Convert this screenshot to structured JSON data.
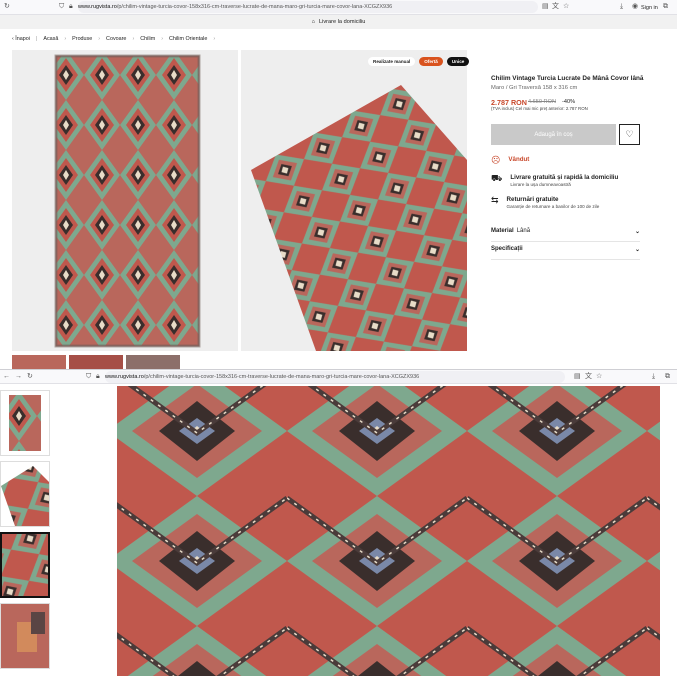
{
  "browser1": {
    "url_host": "www.rugvista.ro",
    "url_path": "/p/chilim-vintage-turcia-covor-158x316-cm-traverse-lucrate-de-mana-maro-gri-turcia-mare-covor-lana-XCGZX936",
    "sign_in": "Sign in"
  },
  "browser2": {
    "url_host": "www.rugvista.ro",
    "url_path": "/p/chilim-vintage-turcia-covor-158x316-cm-traverse-lucrate-de-mana-maro-gri-turcia-mare-covor-lana-XCGZX936"
  },
  "promo": {
    "text": "Livrare la domiciliu"
  },
  "breadcrumb": {
    "back": "Înapoi",
    "items": [
      "Acasă",
      "Produse",
      "Covoare",
      "Chilim",
      "Chilim Orientale"
    ]
  },
  "tags": {
    "manual": "Realizate manual",
    "offer": "Ofertă",
    "unique": "Unice"
  },
  "product": {
    "title": "Chilim Vintage Turcia Lucrate De Mână Covor lână",
    "subtitle": "Maro / Gri Traversă 158 x 316 cm",
    "price": "2.787 RON",
    "old_price": "4.650 RON",
    "discount": "-40%",
    "vat_note": "(TVA inclus) Cel mai mic preț anterior: 2.787 RON",
    "add_to_cart": "Adaugă în coș"
  },
  "features": {
    "sold": "Vândut",
    "free_delivery_title": "Livrare gratuită și rapidă la domiciliu",
    "free_delivery_sub": "Livrare la ușa dumneavoastră",
    "free_returns_title": "Returnări gratuite",
    "free_returns_sub": "Garanție de returnare a banilor de 100 de zile"
  },
  "details": {
    "material_label": "Material",
    "material_value": "Lână",
    "specs_label": "Specificații"
  },
  "colors": {
    "accent": "#c8472a",
    "offer_tag": "#d9531e",
    "rug_red": "#c0584d",
    "rug_green": "#7ea88e",
    "rug_dark": "#3a2e2c",
    "rug_cream": "#e8dcc8"
  },
  "icons": [
    "back-arrow-icon",
    "heart-icon",
    "sold-face-icon",
    "truck-icon",
    "return-icon",
    "chevron-down-icon",
    "reload-icon",
    "shield-icon",
    "lock-icon",
    "download-icon",
    "account-icon",
    "extensions-icon",
    "reader-icon",
    "translate-icon",
    "star-icon",
    "home-icon"
  ]
}
